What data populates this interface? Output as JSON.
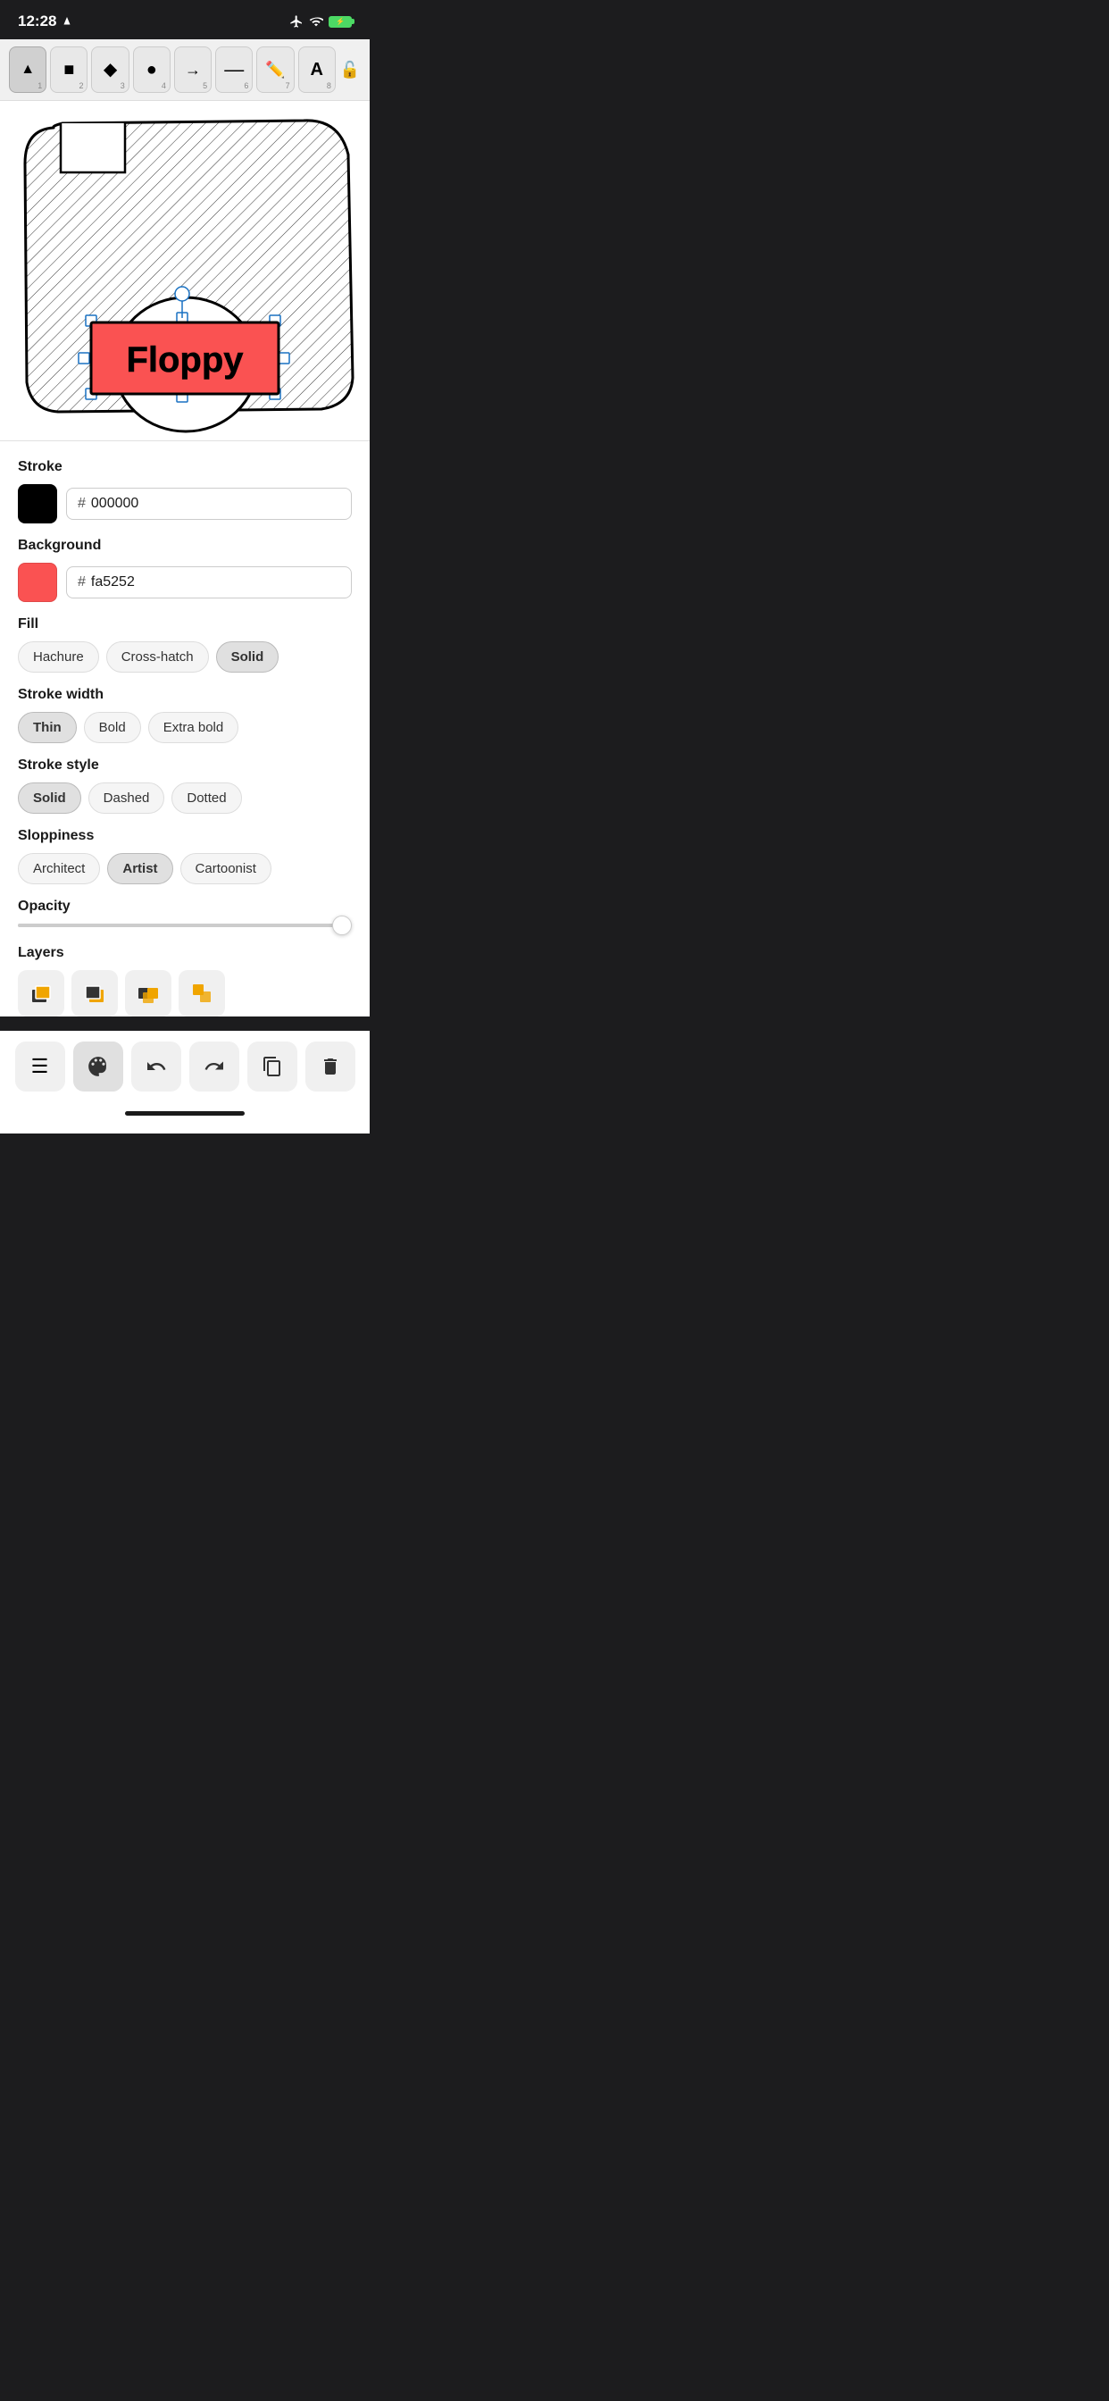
{
  "status": {
    "time": "12:28",
    "airplane_mode": true,
    "wifi": true,
    "battery": 75
  },
  "toolbar": {
    "tools": [
      {
        "id": "select",
        "icon": "▲",
        "num": "1",
        "active": false
      },
      {
        "id": "rectangle",
        "icon": "■",
        "num": "2",
        "active": false
      },
      {
        "id": "diamond",
        "icon": "◆",
        "num": "3",
        "active": false
      },
      {
        "id": "ellipse",
        "icon": "●",
        "num": "4",
        "active": false
      },
      {
        "id": "arrow",
        "icon": "→",
        "num": "5",
        "active": false
      },
      {
        "id": "line",
        "icon": "—",
        "num": "6",
        "active": false
      },
      {
        "id": "pen",
        "icon": "✏",
        "num": "7",
        "active": false
      },
      {
        "id": "text",
        "icon": "A",
        "num": "8",
        "active": false
      }
    ],
    "lock_label": "🔓"
  },
  "stroke": {
    "label": "Stroke",
    "color_hex": "000000",
    "swatch_color": "#000000",
    "hash": "#"
  },
  "background": {
    "label": "Background",
    "color_hex": "fa5252",
    "swatch_color": "#fa5252",
    "hash": "#"
  },
  "fill": {
    "label": "Fill",
    "options": [
      "Hachure",
      "Cross-hatch",
      "Solid"
    ],
    "active": "Solid"
  },
  "stroke_width": {
    "label": "Stroke width",
    "options": [
      "Thin",
      "Bold",
      "Extra bold"
    ],
    "active": "Thin"
  },
  "stroke_style": {
    "label": "Stroke style",
    "options": [
      "Solid",
      "Dashed",
      "Dotted"
    ],
    "active": "Solid"
  },
  "sloppiness": {
    "label": "Sloppiness",
    "options": [
      "Architect",
      "Artist",
      "Cartoonist"
    ],
    "active": "Artist"
  },
  "opacity": {
    "label": "Opacity",
    "value": 100,
    "thumb_percent": 97
  },
  "layers": {
    "label": "Layers",
    "icons": [
      {
        "id": "send-to-back",
        "type": "back"
      },
      {
        "id": "bring-to-front",
        "type": "front"
      },
      {
        "id": "group",
        "type": "group"
      },
      {
        "id": "ungroup",
        "type": "ungroup"
      }
    ]
  },
  "actions": [
    {
      "id": "hamburger",
      "icon": "☰",
      "active": false
    },
    {
      "id": "palette",
      "icon": "🎨",
      "active": true
    },
    {
      "id": "undo",
      "icon": "↺",
      "active": false
    },
    {
      "id": "redo",
      "icon": "↻",
      "active": false
    },
    {
      "id": "duplicate",
      "icon": "⧉",
      "active": false
    },
    {
      "id": "delete",
      "icon": "🗑",
      "active": false
    }
  ]
}
